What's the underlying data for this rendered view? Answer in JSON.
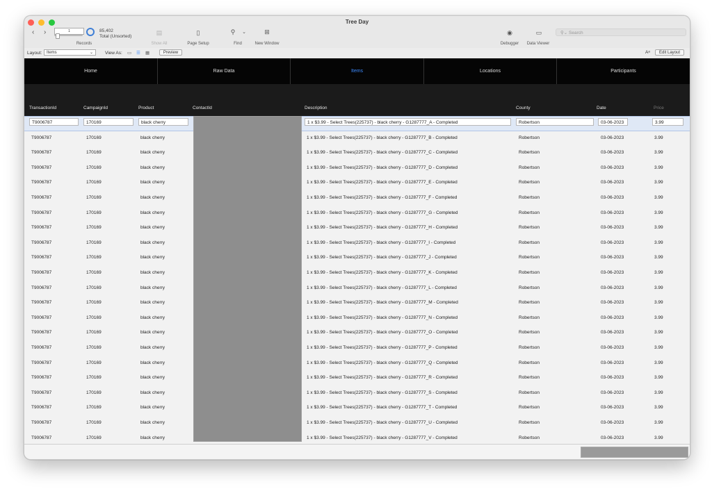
{
  "window": {
    "title": "Tree Day"
  },
  "toolbar": {
    "record_number": "1",
    "record_count": "85,402",
    "record_status": "Total (Unsorted)",
    "records_label": "Records",
    "show_all_label": "Show All",
    "page_setup_label": "Page Setup",
    "find_label": "Find",
    "new_window_label": "New Window",
    "debugger_label": "Debugger",
    "data_viewer_label": "Data Viewer",
    "search_placeholder": "Search"
  },
  "layoutbar": {
    "layout_label": "Layout:",
    "layout_value": "Items",
    "view_as_label": "View As:",
    "preview_label": "Preview",
    "edit_layout_label": "Edit Layout"
  },
  "nav": {
    "tabs": [
      {
        "label": "Home"
      },
      {
        "label": "Raw Data"
      },
      {
        "label": "Items"
      },
      {
        "label": "Locations"
      },
      {
        "label": "Participants"
      }
    ]
  },
  "columns": [
    "TransactionId",
    "CampaignId",
    "Product",
    "ContactId",
    "Description",
    "County",
    "Date",
    "Price"
  ],
  "rows": [
    {
      "transaction_id": "T9006787",
      "campaign_id": "170169",
      "product": "black cherry",
      "description": "1 x $3.99 - Select Trees(225737) - black cherry - G1287777_A - Completed",
      "county": "Robertson",
      "date": "03-06-2023",
      "price": "3.99"
    },
    {
      "transaction_id": "T9006787",
      "campaign_id": "170169",
      "product": "black cherry",
      "description": "1 x $3.99 - Select Trees(225737) - black cherry - G1287777_B - Completed",
      "county": "Robertson",
      "date": "03-06-2023",
      "price": "3.99"
    },
    {
      "transaction_id": "T9006787",
      "campaign_id": "170169",
      "product": "black cherry",
      "description": "1 x $3.99 - Select Trees(225737) - black cherry - G1287777_C - Completed",
      "county": "Robertson",
      "date": "03-06-2023",
      "price": "3.99"
    },
    {
      "transaction_id": "T9006787",
      "campaign_id": "170169",
      "product": "black cherry",
      "description": "1 x $3.99 - Select Trees(225737) - black cherry - G1287777_D - Completed",
      "county": "Robertson",
      "date": "03-06-2023",
      "price": "3.99"
    },
    {
      "transaction_id": "T9006787",
      "campaign_id": "170169",
      "product": "black cherry",
      "description": "1 x $3.99 - Select Trees(225737) - black cherry - G1287777_E - Completed",
      "county": "Robertson",
      "date": "03-06-2023",
      "price": "3.99"
    },
    {
      "transaction_id": "T9006787",
      "campaign_id": "170169",
      "product": "black cherry",
      "description": "1 x $3.99 - Select Trees(225737) - black cherry - G1287777_F - Completed",
      "county": "Robertson",
      "date": "03-06-2023",
      "price": "3.99"
    },
    {
      "transaction_id": "T9006787",
      "campaign_id": "170169",
      "product": "black cherry",
      "description": "1 x $3.99 - Select Trees(225737) - black cherry - G1287777_G - Completed",
      "county": "Robertson",
      "date": "03-06-2023",
      "price": "3.99"
    },
    {
      "transaction_id": "T9006787",
      "campaign_id": "170169",
      "product": "black cherry",
      "description": "1 x $3.99 - Select Trees(225737) - black cherry - G1287777_H - Completed",
      "county": "Robertson",
      "date": "03-06-2023",
      "price": "3.99"
    },
    {
      "transaction_id": "T9006787",
      "campaign_id": "170169",
      "product": "black cherry",
      "description": "1 x $3.99 - Select Trees(225737) - black cherry - G1287777_I - Completed",
      "county": "Robertson",
      "date": "03-06-2023",
      "price": "3.99"
    },
    {
      "transaction_id": "T9006787",
      "campaign_id": "170169",
      "product": "black cherry",
      "description": "1 x $3.99 - Select Trees(225737) - black cherry - G1287777_J - Completed",
      "county": "Robertson",
      "date": "03-06-2023",
      "price": "3.99"
    },
    {
      "transaction_id": "T9006787",
      "campaign_id": "170169",
      "product": "black cherry",
      "description": "1 x $3.99 - Select Trees(225737) - black cherry - G1287777_K - Completed",
      "county": "Robertson",
      "date": "03-06-2023",
      "price": "3.99"
    },
    {
      "transaction_id": "T9006787",
      "campaign_id": "170169",
      "product": "black cherry",
      "description": "1 x $3.99 - Select Trees(225737) - black cherry - G1287777_L - Completed",
      "county": "Robertson",
      "date": "03-06-2023",
      "price": "3.99"
    },
    {
      "transaction_id": "T9006787",
      "campaign_id": "170169",
      "product": "black cherry",
      "description": "1 x $3.99 - Select Trees(225737) - black cherry - G1287777_M - Completed",
      "county": "Robertson",
      "date": "03-06-2023",
      "price": "3.99"
    },
    {
      "transaction_id": "T9006787",
      "campaign_id": "170169",
      "product": "black cherry",
      "description": "1 x $3.99 - Select Trees(225737) - black cherry - G1287777_N - Completed",
      "county": "Robertson",
      "date": "03-06-2023",
      "price": "3.99"
    },
    {
      "transaction_id": "T9006787",
      "campaign_id": "170169",
      "product": "black cherry",
      "description": "1 x $3.99 - Select Trees(225737) - black cherry - G1287777_O - Completed",
      "county": "Robertson",
      "date": "03-06-2023",
      "price": "3.99"
    },
    {
      "transaction_id": "T9006787",
      "campaign_id": "170169",
      "product": "black cherry",
      "description": "1 x $3.99 - Select Trees(225737) - black cherry - G1287777_P - Completed",
      "county": "Robertson",
      "date": "03-06-2023",
      "price": "3.99"
    },
    {
      "transaction_id": "T9006787",
      "campaign_id": "170169",
      "product": "black cherry",
      "description": "1 x $3.99 - Select Trees(225737) - black cherry - G1287777_Q - Completed",
      "county": "Robertson",
      "date": "03-06-2023",
      "price": "3.99"
    },
    {
      "transaction_id": "T9006787",
      "campaign_id": "170169",
      "product": "black cherry",
      "description": "1 x $3.99 - Select Trees(225737) - black cherry - G1287777_R - Completed",
      "county": "Robertson",
      "date": "03-06-2023",
      "price": "3.99"
    },
    {
      "transaction_id": "T9006787",
      "campaign_id": "170169",
      "product": "black cherry",
      "description": "1 x $3.99 - Select Trees(225737) - black cherry - G1287777_S - Completed",
      "county": "Robertson",
      "date": "03-06-2023",
      "price": "3.99"
    },
    {
      "transaction_id": "T9006787",
      "campaign_id": "170169",
      "product": "black cherry",
      "description": "1 x $3.99 - Select Trees(225737) - black cherry - G1287777_T - Completed",
      "county": "Robertson",
      "date": "03-06-2023",
      "price": "3.99"
    },
    {
      "transaction_id": "T9006787",
      "campaign_id": "170169",
      "product": "black cherry",
      "description": "1 x $3.99 - Select Trees(225737) - black cherry - G1287777_U - Completed",
      "county": "Robertson",
      "date": "03-06-2023",
      "price": "3.99"
    },
    {
      "transaction_id": "T9006787",
      "campaign_id": "170169",
      "product": "black cherry",
      "description": "1 x $3.99 - Select Trees(225737) - black cherry - G1287777_V - Completed",
      "county": "Robertson",
      "date": "03-06-2023",
      "price": "3.99"
    }
  ],
  "colors": {
    "accent": "#3d8bff",
    "nav_background": "#050505",
    "close": "#fe5f57",
    "minimize": "#febc2e",
    "zoom": "#28c840"
  },
  "icons": [
    "back-arrow-icon",
    "forward-arrow-icon",
    "records-pie-icon",
    "show-all-icon",
    "page-setup-icon",
    "find-magnifier-icon",
    "new-window-icon",
    "debugger-bug-icon",
    "data-viewer-icon",
    "search-icon",
    "form-view-icon",
    "list-view-icon",
    "table-view-icon",
    "text-format-icon"
  ]
}
